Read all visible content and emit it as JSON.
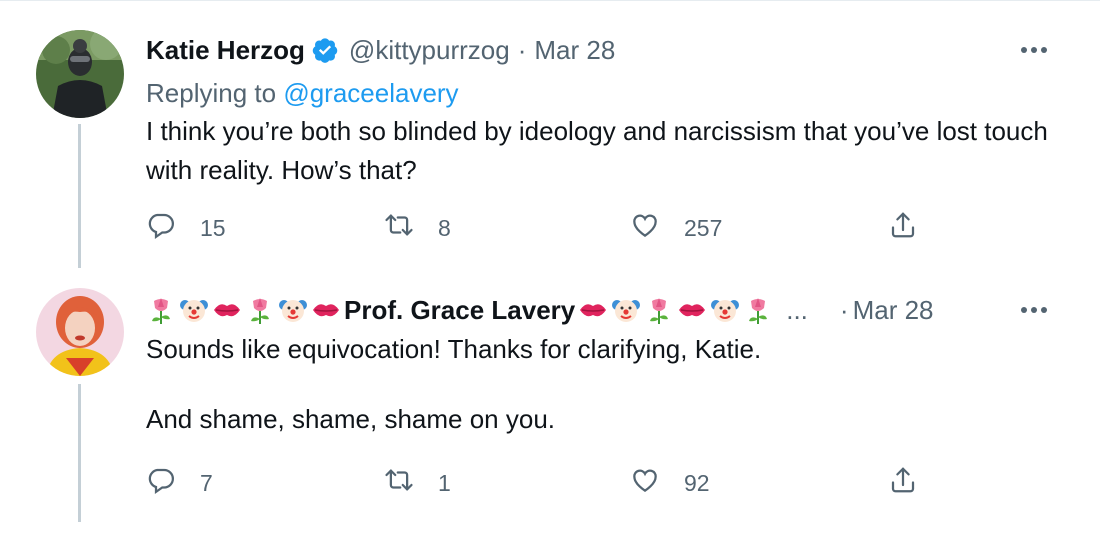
{
  "tweets": [
    {
      "author_name": "Katie Herzog",
      "handle": "@kittypurrzog",
      "separator": "·",
      "date": "Mar 28",
      "replying_prefix": "Replying to ",
      "replying_to": "@graceelavery",
      "text": "I think you’re both so blinded by ideology and narcissism that you’ve lost touch with reality. How’s that?",
      "counts": {
        "reply": "15",
        "retweet": "8",
        "like": "257"
      },
      "verified": true
    },
    {
      "author_name": "Prof. Grace Lavery",
      "name_emojis_before": [
        "tulip",
        "clown-face",
        "kiss-mark",
        "tulip",
        "clown-face",
        "kiss-mark"
      ],
      "name_emojis_after": [
        "kiss-mark",
        "clown-face",
        "tulip",
        "kiss-mark",
        "clown-face",
        "tulip"
      ],
      "truncation": "...",
      "separator": "·",
      "date": "Mar 28",
      "text": "Sounds like equivocation! Thanks for clarifying, Katie.\n\nAnd shame, shame, shame on you.",
      "counts": {
        "reply": "7",
        "retweet": "1",
        "like": "92"
      }
    }
  ],
  "colors": {
    "link": "#1d9bf0",
    "secondary_text": "#536471",
    "thread_line": "#c4cfd6",
    "verified_badge": "#1d9bf0"
  },
  "icons": [
    "reply-icon",
    "retweet-icon",
    "like-icon",
    "share-icon",
    "more-icon",
    "verified-badge-icon"
  ]
}
